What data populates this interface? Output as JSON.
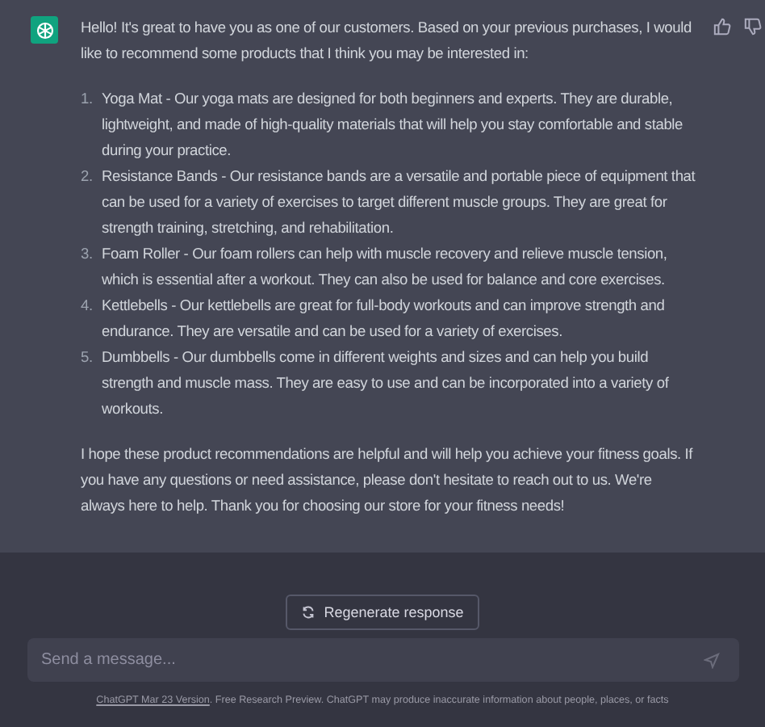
{
  "message": {
    "intro": "Hello! It's great to have you as one of our customers. Based on your previous purchases, I would like to recommend some products that I think you may be interested in:",
    "items": [
      {
        "number": "1.",
        "text": "Yoga Mat - Our yoga mats are designed for both beginners and experts. They are durable, lightweight, and made of high-quality materials that will help you stay comfortable and stable during your practice."
      },
      {
        "number": "2.",
        "text": "Resistance Bands - Our resistance bands are a versatile and portable piece of equipment that can be used for a variety of exercises to target different muscle groups. They are great for strength training, stretching, and rehabilitation."
      },
      {
        "number": "3.",
        "text": "Foam Roller - Our foam rollers can help with muscle recovery and relieve muscle tension, which is essential after a workout. They can also be used for balance and core exercises."
      },
      {
        "number": "4.",
        "text": "Kettlebells - Our kettlebells are great for full-body workouts and can improve strength and endurance. They are versatile and can be used for a variety of exercises."
      },
      {
        "number": "5.",
        "text": "Dumbbells - Our dumbbells come in different weights and sizes and can help you build strength and muscle mass. They are easy to use and can be incorporated into a variety of workouts."
      }
    ],
    "closing": "I hope these product recommendations are helpful and will help you achieve your fitness goals. If you have any questions or need assistance, please don't hesitate to reach out to us. We're always here to help. Thank you for choosing our store for your fitness needs!"
  },
  "regenerate_button": "Regenerate response",
  "composer": {
    "placeholder": "Send a message..."
  },
  "footer": {
    "link": "ChatGPT Mar 23 Version",
    "text": ". Free Research Preview. ChatGPT may produce inaccurate information about people, places, or facts"
  }
}
